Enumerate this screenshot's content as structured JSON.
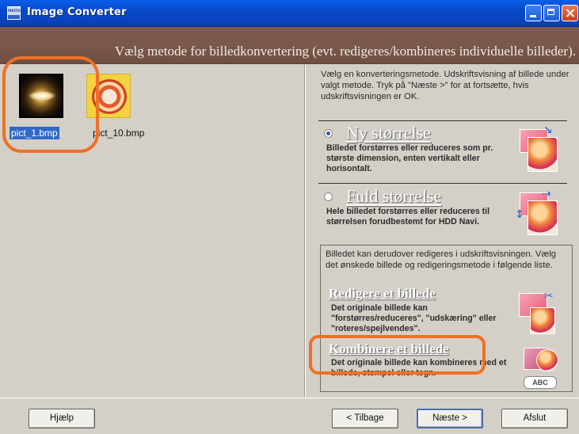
{
  "window": {
    "title": "Image Converter",
    "icon_text": "PHOTO",
    "controls": [
      "minimize-icon",
      "maximize-icon",
      "close-icon"
    ]
  },
  "header": {
    "text": "Vælg  metode for billedkonvertering (evt. redigeres/kombineres individuelle billeder)."
  },
  "thumbnails": [
    {
      "label": "pict_1.bmp",
      "selected": true
    },
    {
      "label": "pict_10.bmp",
      "selected": false
    }
  ],
  "right_panel": {
    "intro": "Vælg en konverteringsmetode. Udskriftsvisning af billede under valgt metode. Tryk på \"Næste >\" for at fortsætte, hvis udskriftsvisningen er OK.",
    "options": [
      {
        "title": "Ny størrelse",
        "selected": true,
        "description": "Billedet forstørres eller reduceres som pr. største dimension, enten vertikalt eller horisontalt."
      },
      {
        "title": "Fuld størrelse",
        "selected": false,
        "description": "Hele billedet forstørres eller reduceres til størrelsen forudbestemt for HDD Navi."
      }
    ],
    "edit_section": {
      "intro": "Billedet kan derudover redigeres i udskriftsvisningen. Vælg det ønskede billede og redigeringsmetode i følgende liste.",
      "items": [
        {
          "title": "Redigere et billede",
          "description": "Det originale billede kan \"forstørres/reduceres\", \"udskæring\" eller \"roteres/spejlvendes\"."
        },
        {
          "title": "Kombinere et billede",
          "description": "Det originale billede kan kombineres med et billede, stempel eller tegn."
        }
      ],
      "stamp_text": "ABC"
    }
  },
  "buttons": {
    "help": "Hjælp",
    "back": "< Tilbage",
    "next": "Næste >",
    "exit": "Afslut"
  },
  "colors": {
    "title_bar": "#0a4ed0",
    "header_band": "#7a584a",
    "panel_bg": "#d4d0c8",
    "selection": "#316ac5",
    "highlight_ring": "#f07027"
  }
}
